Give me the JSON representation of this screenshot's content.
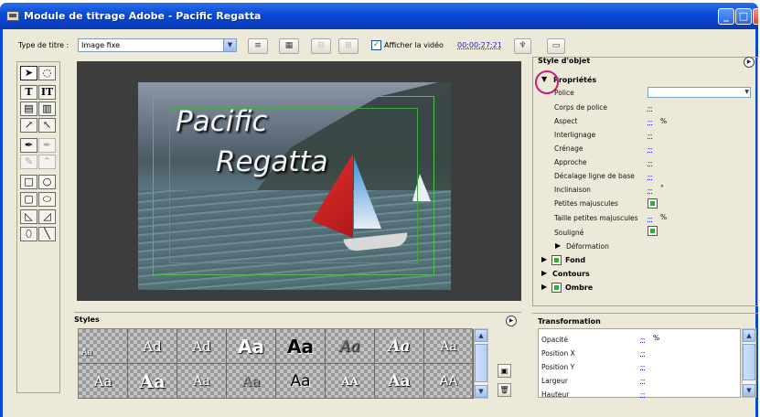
{
  "window": {
    "title": "Module de titrage Adobe - Pacific Regatta",
    "min_label": "_",
    "max_label": "□",
    "close_label": "✕"
  },
  "toolbar": {
    "title_type_label": "Type de titre :",
    "title_type_value": "Image fixe",
    "show_video_checked": true,
    "show_video_label": "Afficher la vidéo",
    "timecode": "00;00;27;21"
  },
  "video": {
    "title_line1": "Pacific",
    "title_line2": "Regatta"
  },
  "styles": {
    "header": "Styles",
    "swatches": [
      {
        "text": "Aa",
        "font": "DejaVu Serif",
        "size": 9,
        "weight": "normal",
        "color": "#ffffff",
        "style": "normal"
      },
      {
        "text": "Ad",
        "font": "DejaVu Serif",
        "size": 15,
        "weight": "normal",
        "color": "#ffffff",
        "style": "normal"
      },
      {
        "text": "Ad",
        "font": "DejaVu Serif",
        "size": 15,
        "weight": "normal",
        "color": "#ffffff",
        "style": "normal"
      },
      {
        "text": "Aa",
        "font": "DejaVu Sans",
        "size": 20,
        "weight": "bold",
        "color": "#ffffff",
        "style": "normal"
      },
      {
        "text": "Aa",
        "font": "DejaVu Sans",
        "size": 20,
        "weight": "bold",
        "color": "#000000",
        "style": "normal"
      },
      {
        "text": "Aa",
        "font": "DejaVu Serif",
        "size": 17,
        "weight": "normal",
        "color": "#666666",
        "style": "italic"
      },
      {
        "text": "Aa",
        "font": "DejaVu Serif",
        "size": 17,
        "weight": "bold",
        "color": "#ffffff",
        "style": "italic"
      },
      {
        "text": "Aa",
        "font": "DejaVu Serif",
        "size": 14,
        "weight": "normal",
        "color": "#ffffff",
        "style": "normal"
      },
      {
        "text": "Aa",
        "font": "DejaVu Serif",
        "size": 15,
        "weight": "normal",
        "color": "#ffffff",
        "style": "normal"
      },
      {
        "text": "Aa",
        "font": "DejaVu Serif",
        "size": 20,
        "weight": "bold",
        "color": "#ffffff",
        "style": "normal"
      },
      {
        "text": "Aa",
        "font": "DejaVu Serif",
        "size": 14,
        "weight": "normal",
        "color": "#ffffff",
        "style": "normal"
      },
      {
        "text": "Aa",
        "font": "DejaVu Serif",
        "size": 15,
        "weight": "normal",
        "color": "#9a9a9a",
        "style": "normal"
      },
      {
        "text": "Aa",
        "font": "DejaVu Sans",
        "size": 17,
        "weight": "normal",
        "color": "#000000",
        "style": "normal"
      },
      {
        "text": "AA",
        "font": "DejaVu Serif",
        "size": 12,
        "weight": "bold",
        "color": "#ffffff",
        "style": "normal"
      },
      {
        "text": "Aa",
        "font": "DejaVu Serif",
        "size": 17,
        "weight": "bold",
        "color": "#ffffff",
        "style": "normal"
      },
      {
        "text": "AA",
        "font": "DejaVu Sans",
        "size": 14,
        "weight": "normal",
        "color": "#ffffff",
        "style": "normal"
      }
    ]
  },
  "object_style": {
    "header": "Style d'objet",
    "properties_label": "Propriétés",
    "rows": [
      {
        "label": "Police",
        "control": "dropdown",
        "value": ""
      },
      {
        "label": "Corps de police",
        "control": "value",
        "value": "--"
      },
      {
        "label": "Aspect",
        "control": "value",
        "value": "--",
        "unit": "%"
      },
      {
        "label": "Interlignage",
        "control": "value",
        "value": "--"
      },
      {
        "label": "Crénage",
        "control": "value",
        "value": "--"
      },
      {
        "label": "Approche",
        "control": "value",
        "value": "--"
      },
      {
        "label": "Décalage ligne de base",
        "control": "value",
        "value": "--"
      },
      {
        "label": "Inclinaison",
        "control": "value",
        "value": "--",
        "unit": "°"
      },
      {
        "label": "Petites majuscules",
        "control": "checkbox"
      },
      {
        "label": "Taille petites majuscules",
        "control": "value",
        "value": "--",
        "unit": "%"
      },
      {
        "label": "Souligné",
        "control": "checkbox"
      }
    ],
    "deformation_label": "Déformation",
    "fond_label": "Fond",
    "contours_label": "Contours",
    "ombre_label": "Ombre"
  },
  "transformation": {
    "header": "Transformation",
    "rows": [
      {
        "label": "Opacité",
        "value": "--",
        "unit": "%"
      },
      {
        "label": "Position X",
        "value": "--"
      },
      {
        "label": "Position Y",
        "value": "--"
      },
      {
        "label": "Largeur",
        "value": "--"
      },
      {
        "label": "Hauteur",
        "value": "--"
      }
    ]
  },
  "colors": {
    "titlebar": "#0a48d6",
    "frame_bg": "#ece9d8",
    "link_blue": "#1a1ad0",
    "check_green": "#2fae2f",
    "safe_zone_green": "#4cbf4c",
    "annotation_magenta": "#c0207a"
  },
  "icons": [
    "app-icon",
    "minimize-icon",
    "maximize-icon",
    "close-icon",
    "dropdown-arrow-icon",
    "roll-crawl-options-icon",
    "templates-icon",
    "align-left-icon",
    "align-right-icon",
    "tab-stops-icon",
    "timecode-marker-icon",
    "export-frame-icon",
    "panel-menu-icon",
    "selection-tool-icon",
    "rotate-tool-icon",
    "type-tool-icon",
    "vertical-type-tool-icon",
    "area-type-tool-icon",
    "vertical-area-type-tool-icon",
    "path-type-tool-icon",
    "vertical-path-type-tool-icon",
    "pen-tool-icon",
    "delete-anchor-icon",
    "add-anchor-icon",
    "convert-anchor-icon",
    "rectangle-tool-icon",
    "clipped-corner-tool-icon",
    "rounded-corner-tool-icon",
    "rounded-rectangle-tool-icon",
    "wedge-tool-icon",
    "arc-tool-icon",
    "ellipse-tool-icon",
    "line-tool-icon",
    "expand-triangle-icon",
    "new-style-icon",
    "delete-style-icon"
  ]
}
